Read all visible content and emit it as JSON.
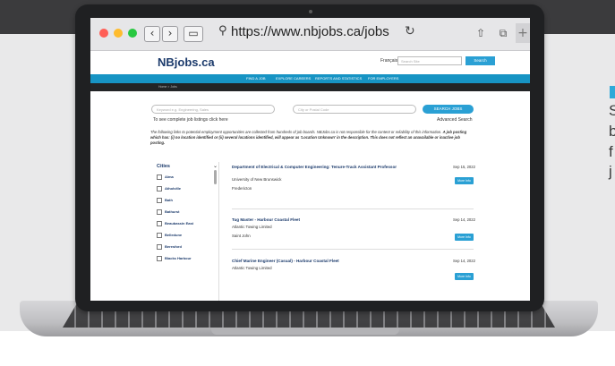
{
  "browser": {
    "url": "https://www.nbjobs.ca/jobs",
    "traffic_colors": [
      "#ff5f57",
      "#febc2e",
      "#28c840"
    ]
  },
  "site": {
    "logo": "NBjobs.ca",
    "language": "Français",
    "search_placeholder": "Search Site",
    "search_button": "Search",
    "nav": [
      "FIND A JOB",
      "EXPLORE CAREERS",
      "REPORTS AND STATISTICS",
      "FOR EMPLOYERS"
    ],
    "breadcrumb": "Home  >  Jobs",
    "keyword_placeholder": "Keyword e.g. Engineering, Sales",
    "city_placeholder": "City or Postal Code",
    "search_jobs": "SEARCH JOBS",
    "complete_listings": "To see complete job listings click here",
    "advanced_search": "Advanced Search",
    "disclaimer_part1": "The following links to potential employment opportunities are collected from hundreds of job boards. NBJobs.ca is not responsible for the content or reliability of this information. ",
    "disclaimer_bold": "A job posting which has: (i) no location identified or (ii) several locations identified, will appear as 'Location Unknown' in the description. This does not reflect an unavailable or inactive job posting."
  },
  "filter": {
    "title": "Cities",
    "cities": [
      "Alma",
      "Atholville",
      "Bath",
      "Bathurst",
      "Beaubassin East",
      "Belledune",
      "Beresford",
      "Blacks Harbour"
    ]
  },
  "jobs": [
    {
      "title": "Department of Electrical & Computer Engineering: Tenure-Track Assistant Professor",
      "company": "University of New Brunswick",
      "location": "Fredericton",
      "date": "Sep 15, 2022",
      "button": "More Info"
    },
    {
      "title": "Tug Master - Harbour Coastal Fleet",
      "company": "Atlantic Towing Limited",
      "location": "Saint John",
      "date": "Sep 14, 2022",
      "button": "More Info"
    },
    {
      "title": "Chief Marine Engineer (Casual) - Harbour Coastal Fleet",
      "company": "Atlantic Towing Limited",
      "location": "",
      "date": "Sep 14, 2022",
      "button": "More Info"
    }
  ],
  "side_text": {
    "lines": [
      "S",
      "b",
      "f",
      "j"
    ]
  }
}
